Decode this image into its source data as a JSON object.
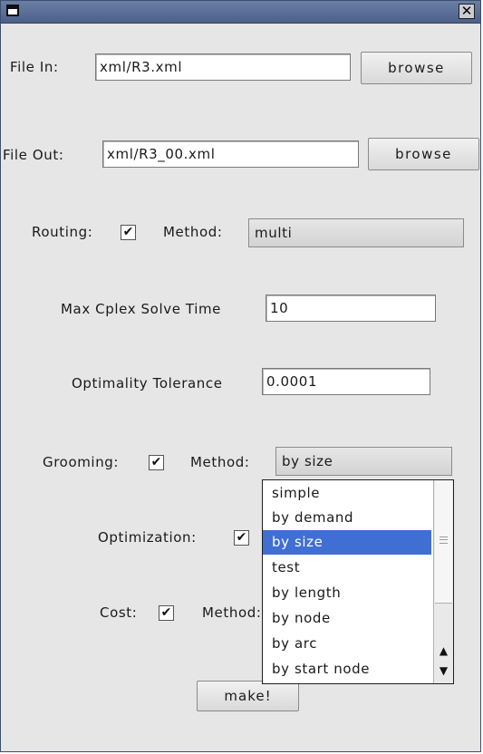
{
  "file_in": {
    "label": "File In:",
    "value": "xml/R3.xml",
    "browse": "browse"
  },
  "file_out": {
    "label": "File Out:",
    "value": "xml/R3_00.xml",
    "browse": "browse"
  },
  "routing": {
    "label": "Routing:",
    "checked": "✔",
    "method_label": "Method:",
    "method_value": "multi"
  },
  "max_cplex": {
    "label": "Max Cplex Solve Time",
    "value": "10"
  },
  "optimality": {
    "label": "Optimality Tolerance",
    "value": "0.0001"
  },
  "grooming": {
    "label": "Grooming:",
    "checked": "✔",
    "method_label": "Method:",
    "method_value": "by size",
    "options": [
      "simple",
      "by demand",
      "by size",
      "test",
      "by length",
      "by node",
      "by arc",
      "by start node"
    ],
    "selected": "by size"
  },
  "optimization": {
    "label": "Optimization:",
    "checked": "✔"
  },
  "cost": {
    "label": "Cost:",
    "checked": "✔",
    "method_label": "Method:"
  },
  "make_button": "make!",
  "icons": {
    "window": "window-menu-icon",
    "close": "close-icon",
    "scroll_up": "arrow-up-icon",
    "scroll_down": "arrow-down-icon"
  },
  "colors": {
    "titlebar": "#4c6089",
    "selection": "#3f6fd2",
    "background": "#e6e6e6"
  }
}
